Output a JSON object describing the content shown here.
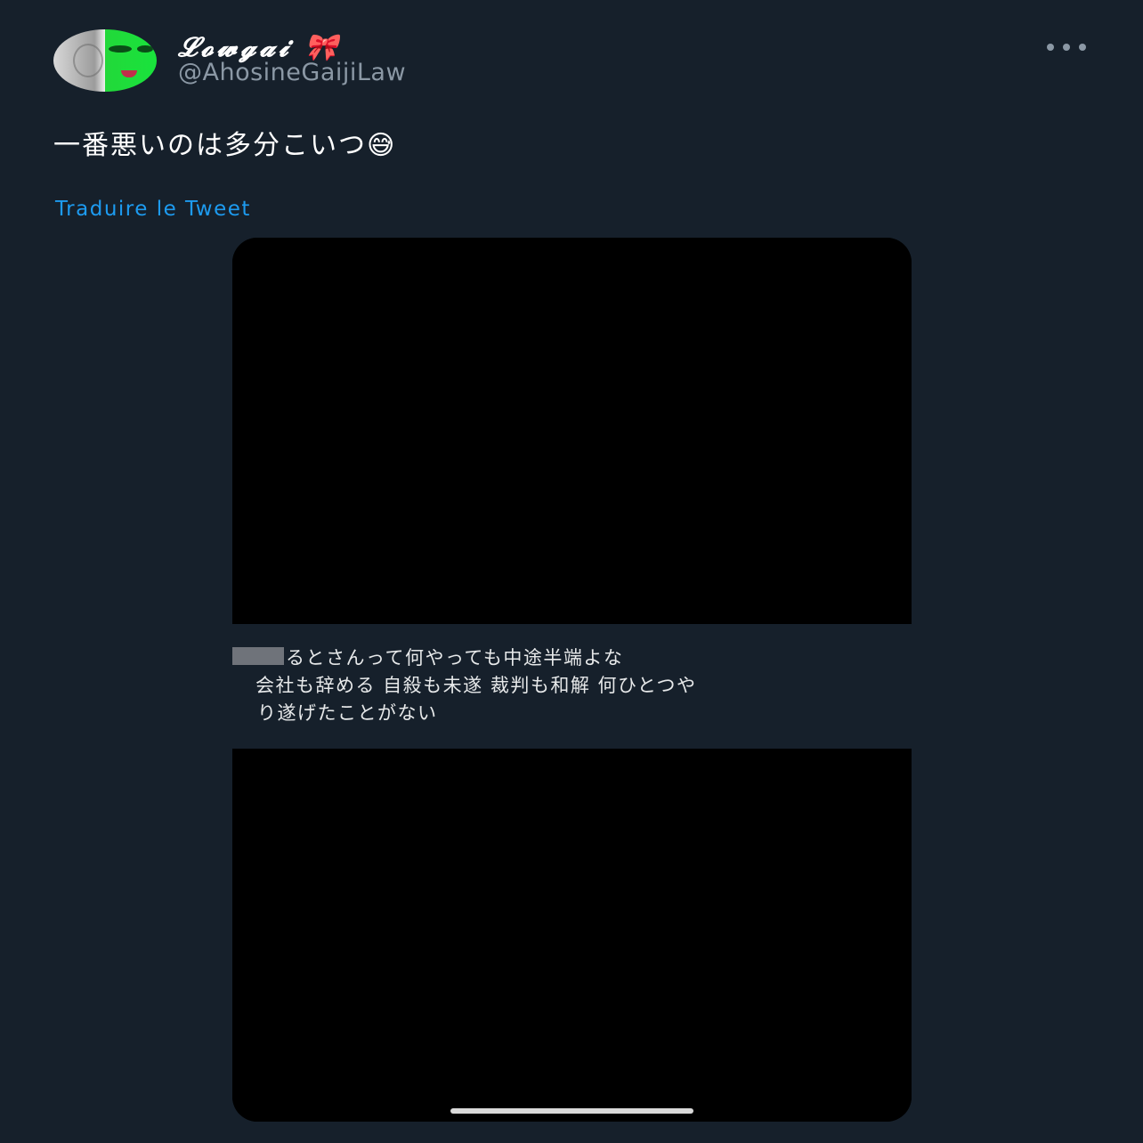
{
  "author": {
    "display_name": "𝓛𝓸𝔀𝓰𝓪𝓲 🎀",
    "handle": "@AhosineGaijiLaw"
  },
  "tweet": {
    "text": "一番悪いのは多分こいつ😅",
    "translate_label": "Traduire le Tweet"
  },
  "media": {
    "caption_lines": [
      "るとさんって何やっても中途半端よな",
      "会社も辞める 自殺も未遂 裁判も和解 何ひとつや",
      "り遂げたことがない"
    ]
  },
  "colors": {
    "background": "#16202b",
    "link": "#1d9bf0",
    "secondary_text": "#8b98a5",
    "avatar_accent": "#19e33c"
  },
  "icons": {
    "more": "more-horizontal-icon"
  }
}
